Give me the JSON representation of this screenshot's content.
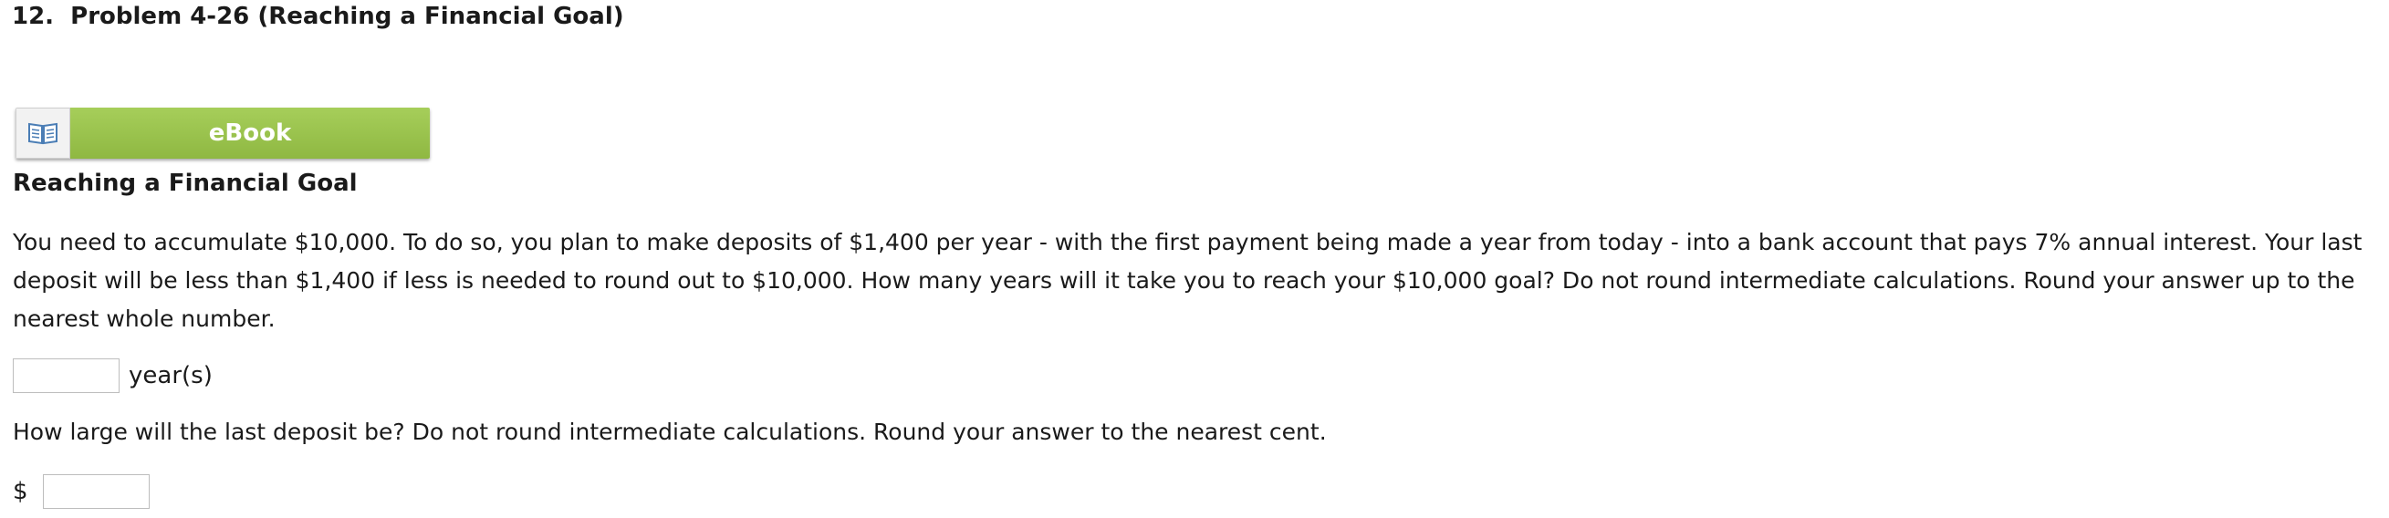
{
  "problem": {
    "number": "12.",
    "title": "Problem 4-26 (Reaching a Financial Goal)"
  },
  "ebook": {
    "label": "eBook",
    "icon": "book-icon"
  },
  "section_title": "Reaching a Financial Goal",
  "question_text": "You need to accumulate $10,000. To do so, you plan to make deposits of $1,400 per year - with the first payment being made a year from today - into a bank account that pays 7% annual interest. Your last deposit will be less than $1,400 if less is needed to round out to $10,000. How many years will it take you to reach your $10,000 goal? Do not round intermediate calculations. Round your answer up to the nearest whole number.",
  "answer_years": {
    "value": "",
    "unit": "year(s)"
  },
  "question_2_text": "How large will the last deposit be? Do not round intermediate calculations. Round your answer to the nearest cent.",
  "answer_deposit": {
    "currency": "$",
    "value": ""
  },
  "colors": {
    "ebook_green": "#9bc34e",
    "icon_blue": "#4a7db5"
  }
}
